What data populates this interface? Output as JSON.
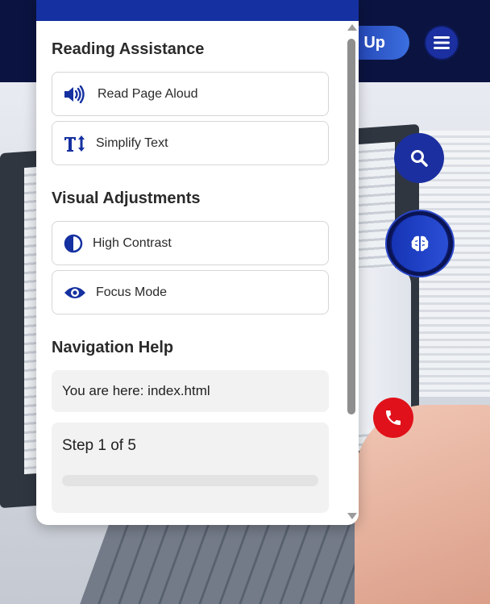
{
  "header": {
    "signup_label": "Up"
  },
  "panel": {
    "sections": {
      "reading": {
        "title": "Reading Assistance"
      },
      "visual": {
        "title": "Visual Adjustments"
      },
      "navigation": {
        "title": "Navigation Help"
      }
    },
    "options": {
      "read_aloud": {
        "label": "Read Page Aloud",
        "icon": "speaker-icon"
      },
      "simplify": {
        "label": "Simplify Text",
        "icon": "text-height-icon"
      },
      "contrast": {
        "label": "High Contrast",
        "icon": "half-circle-icon"
      },
      "focus": {
        "label": "Focus Mode",
        "icon": "eye-icon"
      }
    },
    "location": {
      "text": "You are here: index.html"
    },
    "step": {
      "text": "Step 1 of 5",
      "progress": 0
    }
  },
  "colors": {
    "accent": "#1530a0",
    "call": "#e0111a",
    "header_bg": "#0b1440"
  }
}
